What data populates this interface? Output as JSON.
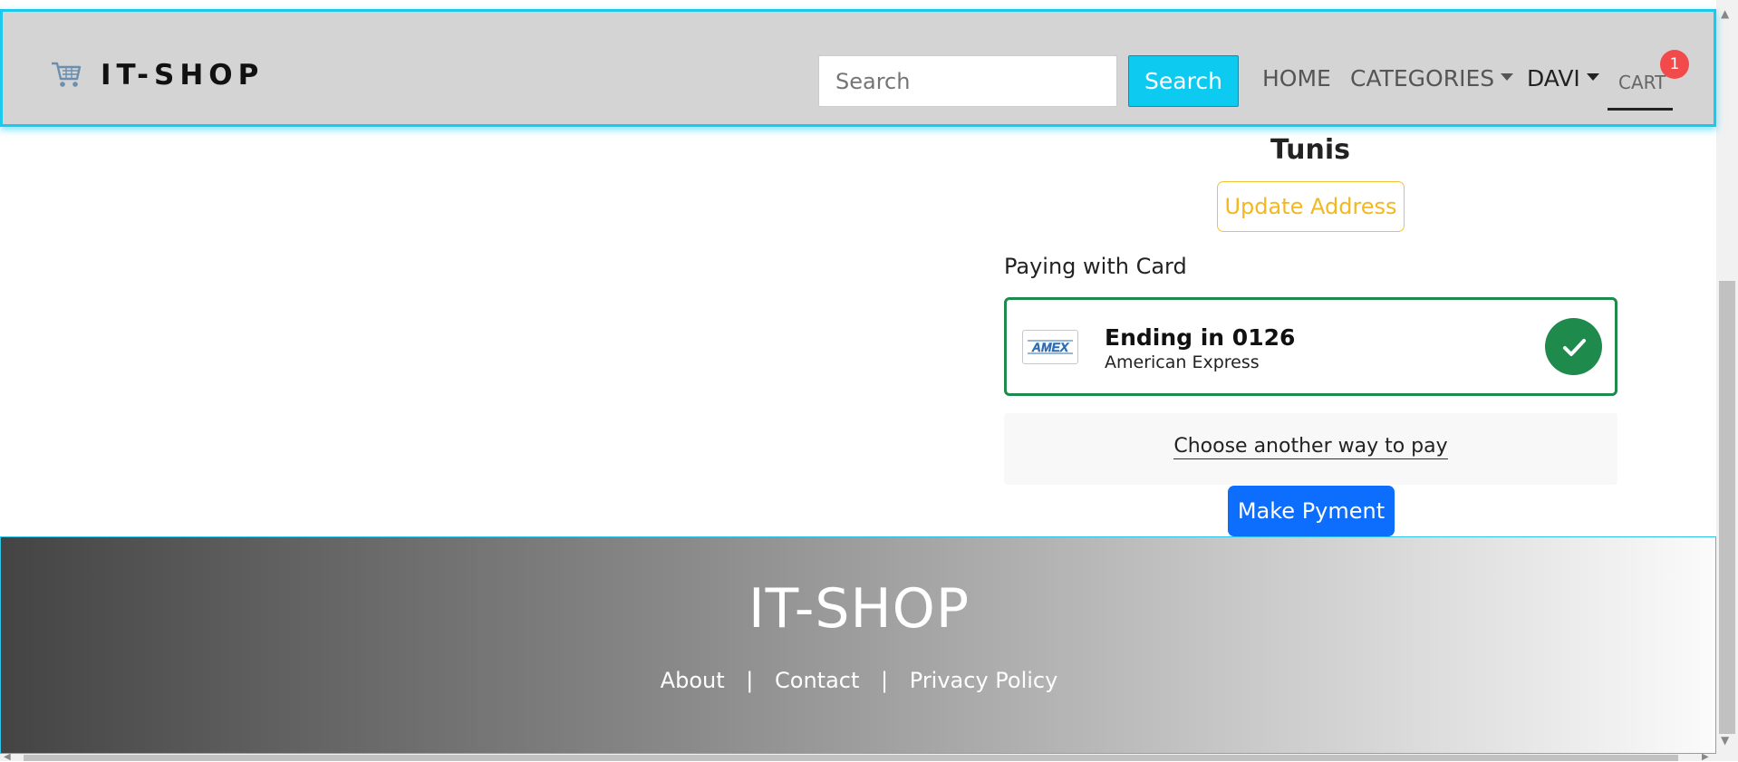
{
  "navbar": {
    "brand": "IT-SHOP",
    "search_placeholder": "Search",
    "search_button": "Search",
    "links": {
      "home": "HOME",
      "categories": "CATEGORIES",
      "user": "DAVI",
      "cart": "CART"
    },
    "cart_count": "1"
  },
  "shipping": {
    "city": "Tunis",
    "update_button": "Update Address"
  },
  "payment": {
    "label": "Paying with Card",
    "card": {
      "brand_logo_text": "AMEX",
      "title": "Ending in 0126",
      "network": "American Express",
      "selected": true
    },
    "alt_link": "Choose another way to pay",
    "submit_button": "Make Pyment"
  },
  "footer": {
    "title": "IT-SHOP",
    "links": [
      "About",
      "Contact",
      "Privacy Policy"
    ],
    "separator": "|"
  },
  "colors": {
    "nav_bg": "#d4d4d4",
    "nav_border": "#1cc8ee",
    "search_button": "#0dcaf0",
    "badge": "#f24a4a",
    "warning": "#f3c232",
    "success": "#1e8a4c",
    "primary": "#0d6efd"
  },
  "icons": {
    "brand": "shopping-cart-icon",
    "selected": "check-icon",
    "card": "amex-logo"
  }
}
